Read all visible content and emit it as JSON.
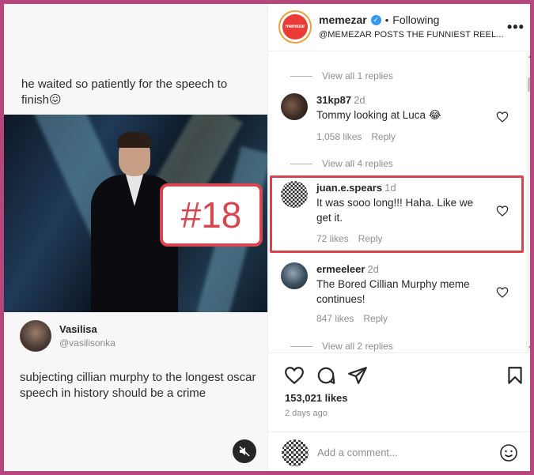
{
  "post": {
    "top_text": "he waited so patiently for the speech to finish😖",
    "badge": "#18",
    "author_name": "Vasilisa",
    "author_handle": "@vasilisonka",
    "body": "subjecting cillian murphy to the longest oscar speech in history should be a crime"
  },
  "header": {
    "avatar_text": "memezar",
    "username": "memezar",
    "verified_mark": "✓",
    "dot": "•",
    "follow_state": "Following",
    "subtitle": "@MEMEZAR POSTS THE FUNNIEST REEL...",
    "more": "•••"
  },
  "comments": {
    "view_replies_1": "View all 1 replies",
    "c1": {
      "user": "31kp87",
      "age": "2d",
      "text": "Tommy looking at Luca 😂",
      "likes": "1,058 likes",
      "reply": "Reply"
    },
    "view_replies_2": "View all 4 replies",
    "c2": {
      "user": "juan.e.spears",
      "age": "1d",
      "text": "It was sooo long!!! Haha. Like we get it.",
      "likes": "72 likes",
      "reply": "Reply"
    },
    "c3": {
      "user": "ermeeleer",
      "age": "2d",
      "text": "The Bored Cillian Murphy meme continues!",
      "likes": "847 likes",
      "reply": "Reply"
    },
    "view_replies_3": "View all 2 replies"
  },
  "actions": {
    "likes": "153,021 likes",
    "date": "2 days ago"
  },
  "add_comment": {
    "placeholder": "Add a comment..."
  },
  "colors": {
    "frame": "#b6467c",
    "highlight": "#d8454f",
    "verified": "#3897f0"
  },
  "icons": [
    "heart-icon",
    "comment-icon",
    "share-icon",
    "bookmark-icon",
    "mute-icon",
    "emoji-icon",
    "more-icon"
  ]
}
